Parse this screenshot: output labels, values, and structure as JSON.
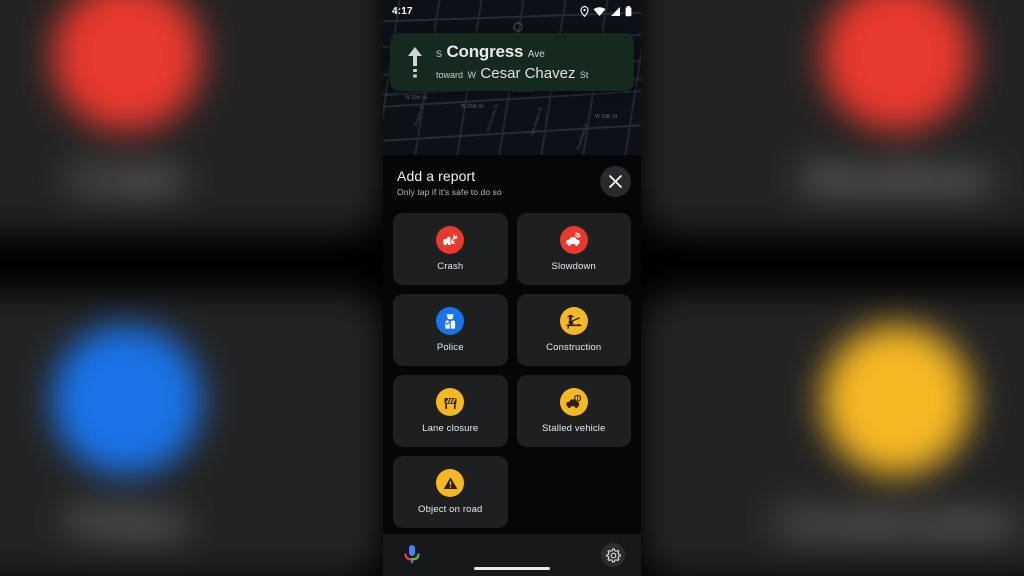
{
  "colors": {
    "red": "#e8392e",
    "blue": "#1a73e8",
    "yellow": "#f5b825",
    "banner_green": "#16291f",
    "sheet_bg": "#060606",
    "tile_bg": "#1e1f20"
  },
  "status_bar": {
    "time": "4:17",
    "icons": [
      "location-pin-icon",
      "wifi-icon",
      "signal-icon",
      "battery-icon"
    ]
  },
  "navigation": {
    "maneuver_icon": "straight-arrow-icon",
    "street_prefix": "S",
    "street_name": "Congress",
    "street_suffix": "Ave",
    "toward_prefix": "toward",
    "toward_dir": "W",
    "toward_name": "Cesar Chavez",
    "toward_suffix": "St"
  },
  "map": {
    "street_labels": [
      "W 16th St",
      "W 16th St",
      "W 16th St",
      "W 15th St",
      "W 15th St"
    ]
  },
  "sheet": {
    "title": "Add a report",
    "subtitle": "Only tap if it's safe to do so",
    "close_icon": "close-icon",
    "tiles": [
      {
        "label": "Crash",
        "icon": "crash-icon",
        "color": "#e8392e"
      },
      {
        "label": "Slowdown",
        "icon": "slowdown-icon",
        "color": "#e8392e"
      },
      {
        "label": "Police",
        "icon": "police-icon",
        "color": "#1a73e8"
      },
      {
        "label": "Construction",
        "icon": "construction-icon",
        "color": "#f5b825"
      },
      {
        "label": "Lane closure",
        "icon": "lane-closure-icon",
        "color": "#f5b825"
      },
      {
        "label": "Stalled vehicle",
        "icon": "stalled-vehicle-icon",
        "color": "#f5b825"
      },
      {
        "label": "Object on road",
        "icon": "object-on-road-icon",
        "color": "#f5b825"
      }
    ]
  },
  "bottom_bar": {
    "mic_icon": "assistant-mic-icon",
    "settings_icon": "gear-icon",
    "home_indicator": "home-indicator"
  },
  "background_preview": {
    "tiles": [
      {
        "label": "Crash",
        "color": "#e8392e"
      },
      {
        "label": "Slowdown",
        "color": "#e8392e"
      },
      {
        "label": "Police",
        "color": "#1a73e8"
      },
      {
        "label": "Construction",
        "color": "#f5b825"
      }
    ]
  }
}
